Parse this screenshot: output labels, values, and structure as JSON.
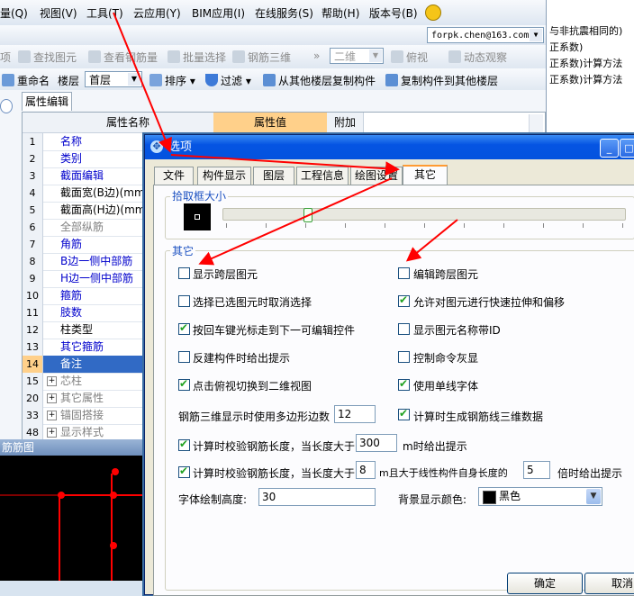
{
  "menu": {
    "items": [
      "量(Q)",
      "视图(V)",
      "工具(T)",
      "云应用(Y)",
      "BIM应用(I)",
      "在线服务(S)",
      "帮助(H)",
      "版本号(B)"
    ]
  },
  "right_pane": {
    "lines": [
      "与非抗震相同的)",
      "正系数)",
      "正系数)计算方法",
      "正系数)计算方法"
    ]
  },
  "account": {
    "email": "forpk.chen@163.com"
  },
  "toolbar1": {
    "find": "查找图元",
    "view_rebar": "查看钢筋量",
    "batch_select": "批量选择",
    "rebar_3d": "钢筋三维",
    "view_mode": "二维",
    "top_view": "俯视",
    "dynamic_view": "动态观察"
  },
  "toolbar2": {
    "rename": "重命名",
    "floor_label": "楼层",
    "floor_value": "首层",
    "sort": "排序",
    "filter": "过滤",
    "copy_from": "从其他楼层复制构件",
    "copy_to": "复制构件到其他楼层"
  },
  "property_panel": {
    "tab": "属性编辑",
    "col_name": "属性名称",
    "col_value": "属性值",
    "col_extra": "附加",
    "rows": [
      {
        "num": "1",
        "name": "名称",
        "style": "blue",
        "expand": false
      },
      {
        "num": "2",
        "name": "类别",
        "style": "blue",
        "expand": false
      },
      {
        "num": "3",
        "name": "截面编辑",
        "style": "blue",
        "expand": false
      },
      {
        "num": "4",
        "name": "截面宽(B边)(mm)",
        "style": "black",
        "expand": false
      },
      {
        "num": "5",
        "name": "截面高(H边)(mm)",
        "style": "black",
        "expand": false
      },
      {
        "num": "6",
        "name": "全部纵筋",
        "style": "gray",
        "expand": false
      },
      {
        "num": "7",
        "name": "角筋",
        "style": "blue",
        "expand": false
      },
      {
        "num": "8",
        "name": "B边一侧中部筋",
        "style": "blue",
        "expand": false
      },
      {
        "num": "9",
        "name": "H边一侧中部筋",
        "style": "blue",
        "expand": false
      },
      {
        "num": "10",
        "name": "箍筋",
        "style": "blue",
        "expand": false
      },
      {
        "num": "11",
        "name": "肢数",
        "style": "blue",
        "expand": false
      },
      {
        "num": "12",
        "name": "柱类型",
        "style": "black",
        "expand": false
      },
      {
        "num": "13",
        "name": "其它箍筋",
        "style": "blue",
        "expand": false
      },
      {
        "num": "14",
        "name": "备注",
        "style": "black",
        "expand": false,
        "selected": true
      },
      {
        "num": "15",
        "name": "芯柱",
        "style": "gray",
        "expand": true
      },
      {
        "num": "20",
        "name": "其它属性",
        "style": "gray",
        "expand": true
      },
      {
        "num": "33",
        "name": "锚固搭接",
        "style": "gray",
        "expand": true
      },
      {
        "num": "48",
        "name": "显示样式",
        "style": "gray",
        "expand": true
      }
    ]
  },
  "rebar_view": {
    "title": "筋筋图"
  },
  "dialog": {
    "title": "选项",
    "tabs": [
      "文件",
      "构件显示",
      "图层",
      "工程信息",
      "绘图设置",
      "其它"
    ],
    "active_tab": 5,
    "pick_box_label": "拾取框大小",
    "pick_box_level": 0.2,
    "other_group_label": "其它",
    "options_left": [
      {
        "label": "显示跨层图元",
        "checked": false
      },
      {
        "label": "选择已选图元时取消选择",
        "checked": false
      },
      {
        "label": "按回车键光标走到下一可编辑控件",
        "checked": true
      },
      {
        "label": "反建构件时给出提示",
        "checked": false
      },
      {
        "label": "点击俯视切换到二维视图",
        "checked": true
      }
    ],
    "options_right": [
      {
        "label": "编辑跨层图元",
        "checked": false
      },
      {
        "label": "允许对图元进行快速拉伸和偏移",
        "checked": true
      },
      {
        "label": "显示图元名称带ID",
        "checked": false
      },
      {
        "label": "控制命令灰显",
        "checked": false
      },
      {
        "label": "使用单线字体",
        "checked": true
      }
    ],
    "polygon_edges_label": "钢筋三维显示时使用多边形边数",
    "polygon_edges_value": "12",
    "gen_3d_label": "计算时生成钢筋线三维数据",
    "gen_3d_checked": true,
    "check1_prefix": "计算时校验钢筋长度，当长度大于",
    "check1_value": "300",
    "check1_suffix": "m时给出提示",
    "check1_checked": true,
    "check2_prefix": "计算时校验钢筋长度，当长度大于",
    "check2_value": "8",
    "check2_mid": "m且大于线性构件自身长度的",
    "check2_value2": "5",
    "check2_suffix": "倍时给出提示",
    "check2_checked": true,
    "font_height_label": "字体绘制高度:",
    "font_height_value": "30",
    "bg_color_label": "背景显示颜色:",
    "bg_color_value": "黑色",
    "bg_color_swatch": "#000000",
    "ok_label": "确定",
    "cancel_label": "取消"
  },
  "colors": {
    "annotation_arrow": "#ff0000",
    "blue_text": "#0000cc",
    "gray_text": "#808080",
    "selected_row": "#316ac5",
    "value_header": "#ffd08a"
  }
}
